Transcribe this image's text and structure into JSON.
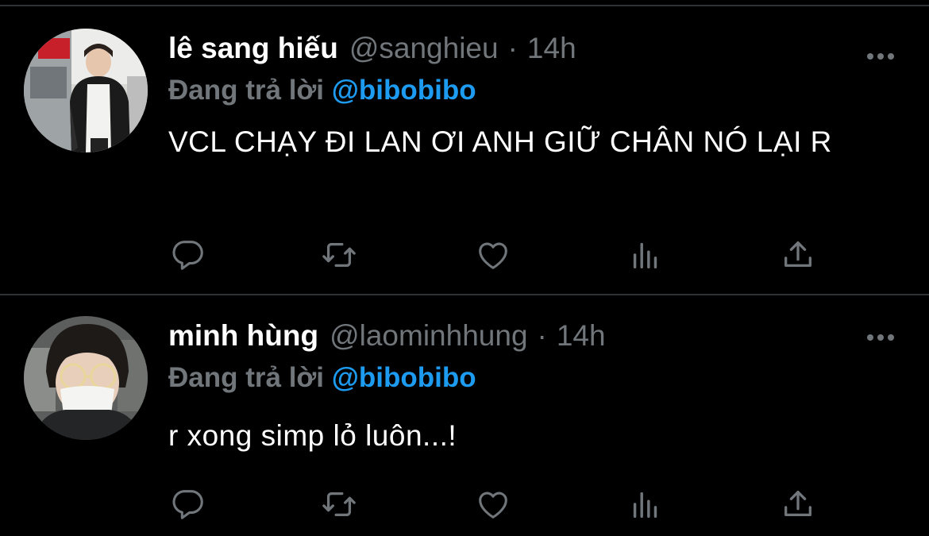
{
  "tweets": [
    {
      "display_name": "lê sang hiếu",
      "handle": "@sanghieu",
      "separator": "·",
      "time": "14h",
      "reply_prefix": "Đang trả lời",
      "reply_to": "@bibobibo",
      "text": "VCL CHẠY ĐI LAN ƠI ANH GIỮ CHÂN NÓ LẠI R"
    },
    {
      "display_name": "minh hùng",
      "handle": "@laominhhung",
      "separator": "·",
      "time": "14h",
      "reply_prefix": "Đang trả lời",
      "reply_to": "@bibobibo",
      "text": "r xong simp lỏ luôn...!"
    }
  ],
  "icons": {
    "reply": "reply-icon",
    "retweet": "retweet-icon",
    "like": "heart-icon",
    "stats": "analytics-icon",
    "share": "share-icon",
    "more": "more-icon"
  },
  "colors": {
    "background": "#000000",
    "name": "#ffffff",
    "muted": "#71767b",
    "mention": "#1d9bf0",
    "divider": "#2f3336"
  }
}
